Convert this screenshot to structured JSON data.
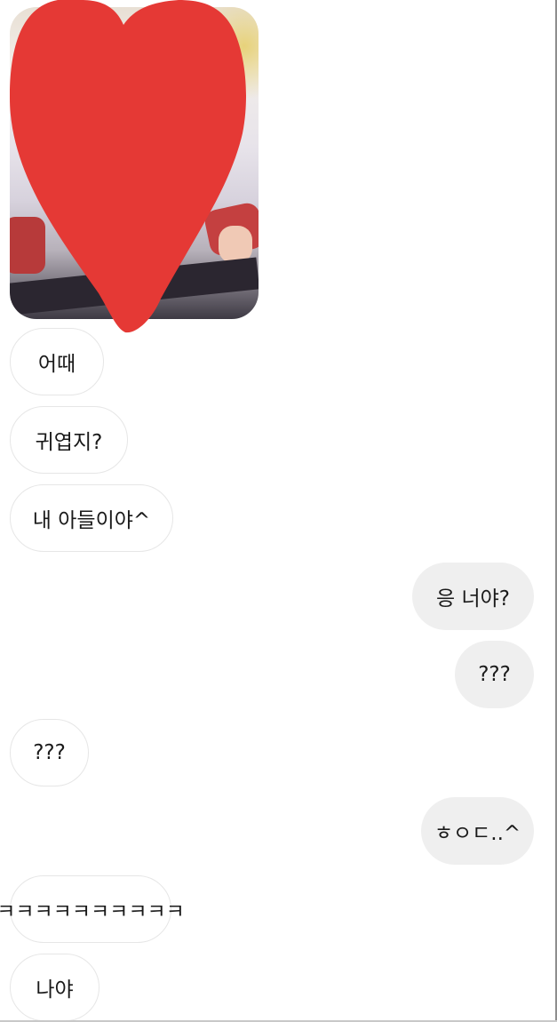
{
  "messages": [
    {
      "sender": "other",
      "text": "어때"
    },
    {
      "sender": "other",
      "text": "귀엽지?"
    },
    {
      "sender": "other",
      "text": "내 아들이야^"
    },
    {
      "sender": "me",
      "text": "응 너야?"
    },
    {
      "sender": "me",
      "text": "???"
    },
    {
      "sender": "other",
      "text": "???"
    },
    {
      "sender": "me",
      "text": "ㅎㅇㄷ..^"
    },
    {
      "sender": "other",
      "text": "ㅋㅋㅋㅋㅋㅋㅋㅋㅋㅋ"
    },
    {
      "sender": "other",
      "text": "나야"
    }
  ],
  "colors": {
    "background": "#ffffff",
    "sent_bubble": "#efefef",
    "received_bubble_border": "#e6e6e6",
    "censor_heart": "#e53935",
    "text": "#1a1a1a"
  },
  "icons": {
    "censor": "heart-icon"
  }
}
